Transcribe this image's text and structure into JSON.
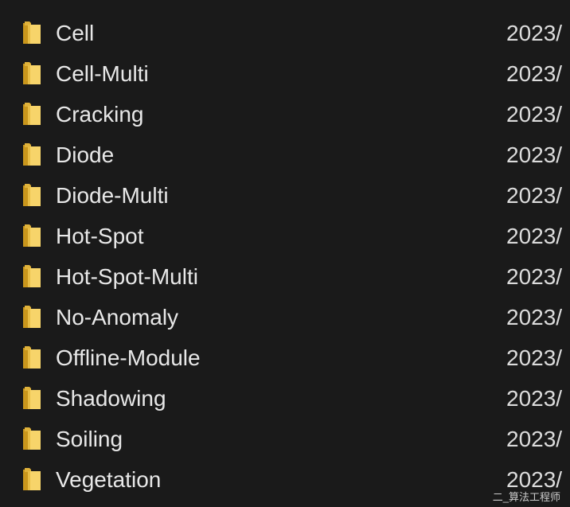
{
  "colors": {
    "background": "#1a1a1a",
    "text": "#e6e6e6",
    "folder_front": "#f7d46a",
    "folder_back": "#d6a626"
  },
  "icons": {
    "folder": "folder-icon"
  },
  "files": [
    {
      "name": "Cell",
      "date": "2023/"
    },
    {
      "name": "Cell-Multi",
      "date": "2023/"
    },
    {
      "name": "Cracking",
      "date": "2023/"
    },
    {
      "name": "Diode",
      "date": "2023/"
    },
    {
      "name": "Diode-Multi",
      "date": "2023/"
    },
    {
      "name": "Hot-Spot",
      "date": "2023/"
    },
    {
      "name": "Hot-Spot-Multi",
      "date": "2023/"
    },
    {
      "name": "No-Anomaly",
      "date": "2023/"
    },
    {
      "name": "Offline-Module",
      "date": "2023/"
    },
    {
      "name": "Shadowing",
      "date": "2023/"
    },
    {
      "name": "Soiling",
      "date": "2023/"
    },
    {
      "name": "Vegetation",
      "date": "2023/"
    }
  ],
  "watermark": "二_算法工程师"
}
